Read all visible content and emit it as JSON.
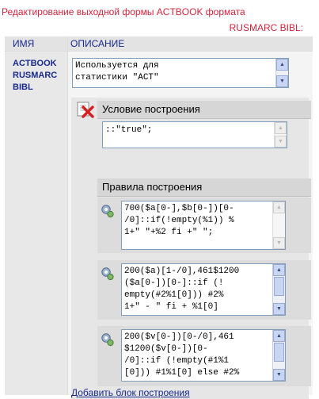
{
  "header": {
    "title": "Редактирование выходной формы ACTBOOK формата",
    "subtitle": "RUSMARC BIBL:"
  },
  "table": {
    "col_name": "ИМЯ",
    "col_desc": "ОПИСАНИЕ",
    "name_lines": [
      "ACTBOOK",
      "RUSMARC",
      "BIBL"
    ],
    "description": "Используется для\nстатистики \"ACT\""
  },
  "condition": {
    "title": "Условие построения",
    "value": "::\"true\";"
  },
  "rules": {
    "title": "Правила построения",
    "items": [
      {
        "text": "700($a[0-],$b[0-])[0-\n/0]::if(!empty(%1)) %\n1+\" \"+%2 fi +\" \";"
      },
      {
        "text": "200($a)[1-/0],461$1200\n($a[0-])[0-]::if (!\nempty(#2%1[0])) #2%\n1+\" - \" fi + %1[0]"
      },
      {
        "text": "200($v[0-])[0-/0],461\n$1200($v[0-])[0-\n/0]::if (!empty(#1%1\n[0])) #1%1[0] else #2%"
      }
    ]
  },
  "add_link": "Добавить блок построения",
  "icons": {
    "delete": "delete-x-icon",
    "gear": "gear-edit-icon"
  }
}
